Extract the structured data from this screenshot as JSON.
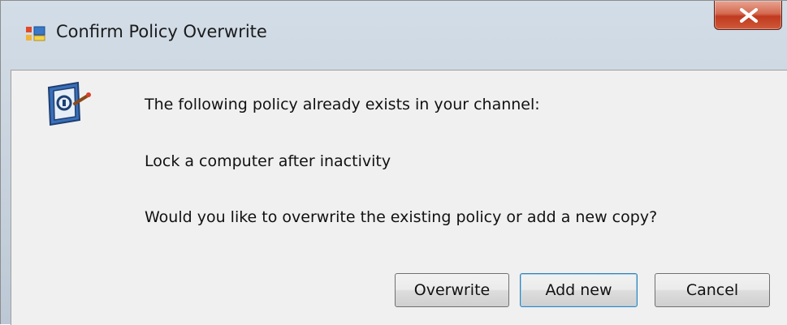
{
  "window": {
    "title": "Confirm Policy Overwrite",
    "app_icon": "policy-app-icon",
    "close_icon": "close-x-icon"
  },
  "dialog": {
    "icon": "lock-policy-icon",
    "line1": "The following policy already exists in your channel:",
    "policy_name": "Lock a computer after inactivity",
    "question": "Would you like to overwrite the existing policy or add a new copy?"
  },
  "buttons": {
    "overwrite_label": "Overwrite",
    "add_new_label": "Add new",
    "cancel_label": "Cancel"
  },
  "colors": {
    "close_button": "#c0391f",
    "client_background": "#f0f0f0",
    "default_button_border": "#3c7fb1"
  }
}
